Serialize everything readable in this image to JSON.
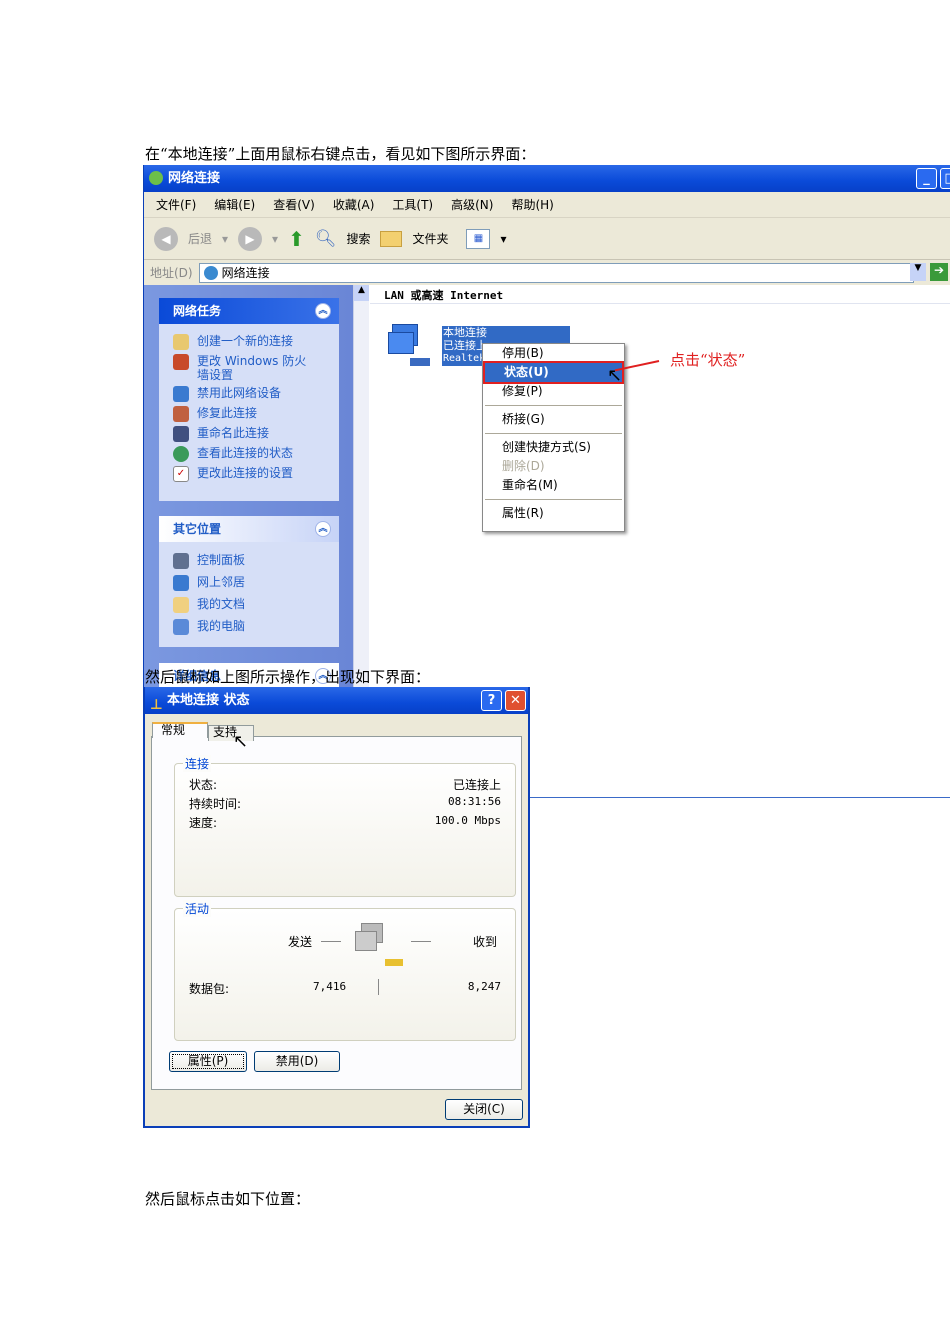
{
  "paragraphs": {
    "p1": "在“本地连接”上面用鼠标右键点击，看见如下图所示界面：",
    "p2": "然后鼠标如上图所示操作，出现如下界面：",
    "p3": "然后鼠标点击如下位置："
  },
  "explorer": {
    "title": "网络连接",
    "menu": [
      "文件(F)",
      "编辑(E)",
      "查看(V)",
      "收藏(A)",
      "工具(T)",
      "高级(N)",
      "帮助(H)"
    ],
    "toolbar": {
      "back": "后退",
      "search": "搜索",
      "folders": "文件夹"
    },
    "address": {
      "label": "地址(D)",
      "value": "网络连接"
    },
    "network_tasks": {
      "title": "网络任务",
      "items": [
        "创建一个新的连接",
        "更改 Windows 防火墙设置",
        "禁用此网络设备",
        "修复此连接",
        "重命名此连接",
        "查看此连接的状态",
        "更改此连接的设置"
      ]
    },
    "other_places": {
      "title": "其它位置",
      "items": [
        "控制面板",
        "网上邻居",
        "我的文档",
        "我的电脑"
      ]
    },
    "details": {
      "title": "详细信息"
    },
    "group_header": "LAN 或高速 Internet",
    "connection": {
      "name": "本地连接",
      "status": "已连接上",
      "adapter": "Realtek"
    },
    "context_menu": [
      "停用(B)",
      "状态(U)",
      "修复(P)",
      "桥接(G)",
      "创建快捷方式(S)",
      "删除(D)",
      "重命名(M)",
      "属性(R)"
    ],
    "annotation": "点击“状态”"
  },
  "dialog": {
    "title": "本地连接 状态",
    "tabs": [
      "常规",
      "支持"
    ],
    "connection": {
      "label": "连接",
      "status_label": "状态:",
      "status": "已连接上",
      "duration_label": "持续时间:",
      "duration": "08:31:56",
      "speed_label": "速度:",
      "speed": "100.0 Mbps"
    },
    "activity": {
      "label": "活动",
      "sent": "发送",
      "received": "收到",
      "packets_label": "数据包:",
      "packets_sent": "7,416",
      "packets_received": "8,247"
    },
    "buttons": {
      "properties": "属性(P)",
      "disable": "禁用(D)",
      "close": "关闭(C)"
    }
  }
}
